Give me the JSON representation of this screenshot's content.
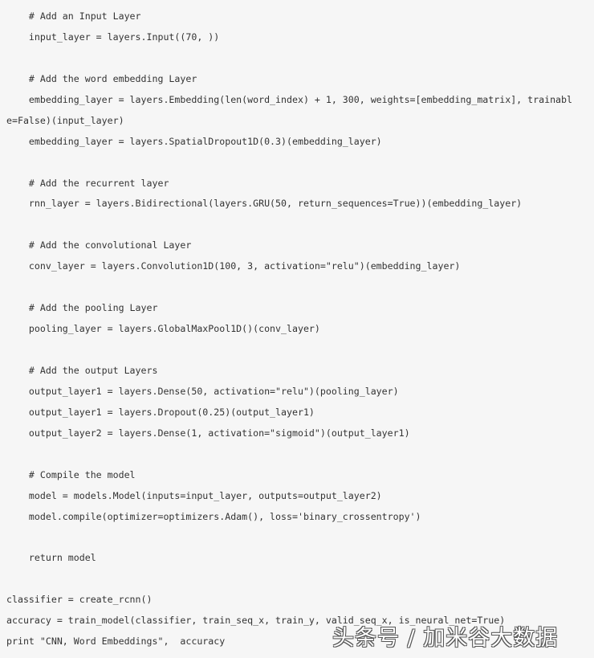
{
  "code_lines": [
    "    # Add an Input Layer",
    "    input_layer = layers.Input((70, ))",
    "",
    "    # Add the word embedding Layer",
    "    embedding_layer = layers.Embedding(len(word_index) + 1, 300, weights=[embedding_matrix], trainabl",
    "e=False)(input_layer)",
    "    embedding_layer = layers.SpatialDropout1D(0.3)(embedding_layer)",
    "",
    "    # Add the recurrent layer",
    "    rnn_layer = layers.Bidirectional(layers.GRU(50, return_sequences=True))(embedding_layer)",
    "",
    "    # Add the convolutional Layer",
    "    conv_layer = layers.Convolution1D(100, 3, activation=\"relu\")(embedding_layer)",
    "",
    "    # Add the pooling Layer",
    "    pooling_layer = layers.GlobalMaxPool1D()(conv_layer)",
    "",
    "    # Add the output Layers",
    "    output_layer1 = layers.Dense(50, activation=\"relu\")(pooling_layer)",
    "    output_layer1 = layers.Dropout(0.25)(output_layer1)",
    "    output_layer2 = layers.Dense(1, activation=\"sigmoid\")(output_layer1)",
    "",
    "    # Compile the model",
    "    model = models.Model(inputs=input_layer, outputs=output_layer2)",
    "    model.compile(optimizer=optimizers.Adam(), loss='binary_crossentropy')",
    "",
    "    return model",
    "",
    "classifier = create_rcnn()",
    "accuracy = train_model(classifier, train_seq_x, train_y, valid_seq_x, is_neural_net=True)",
    "print \"CNN, Word Embeddings\",  accuracy"
  ],
  "watermark": "头条号 / 加米谷大数据",
  "colors": {
    "background": "#f6f6f6",
    "text": "#333333"
  }
}
